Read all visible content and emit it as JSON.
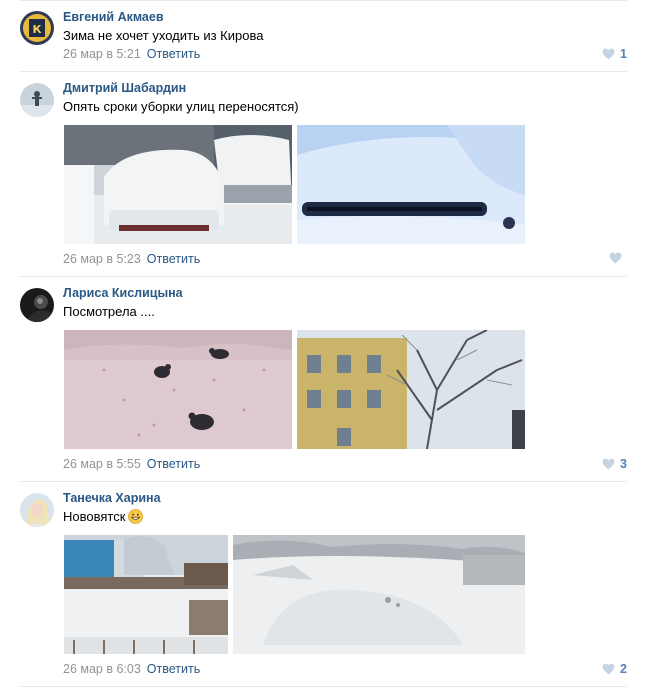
{
  "colors": {
    "link": "#2a5885",
    "meta": "#939393",
    "like": "#5181b8",
    "like_empty": "#c5d3e2",
    "separator": "#e7e8ec"
  },
  "comments": [
    {
      "author": "Евгений Акмаев",
      "text": "Зима не хочет уходить из Кирова",
      "date": "26 мар в 5:21",
      "reply": "Ответить",
      "likes": "1",
      "icon": "heart-icon"
    },
    {
      "author": "Дмитрий Шабардин",
      "text": "Опять сроки уборки улиц переносятся)",
      "date": "26 мар в 5:23",
      "reply": "Ответить",
      "likes": "",
      "icon": "heart-icon"
    },
    {
      "author": "Лариса Кислицына",
      "text": "Посмотрела ....",
      "date": "26 мар в 5:55",
      "reply": "Ответить",
      "likes": "3",
      "icon": "heart-icon"
    },
    {
      "author": "Танечка Харина",
      "text": "Нововятск",
      "emoji": "grinning-face-emoji",
      "date": "26 мар в 6:03",
      "reply": "Ответить",
      "likes": "2",
      "icon": "heart-icon"
    }
  ]
}
